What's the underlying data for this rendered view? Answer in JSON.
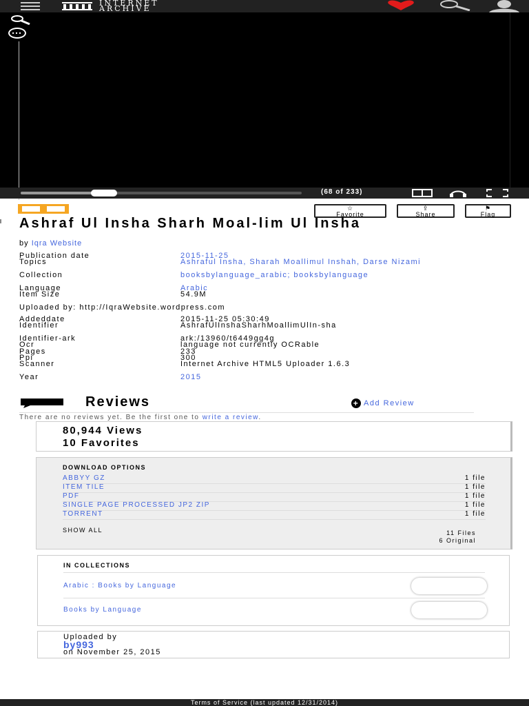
{
  "nav": {
    "logo_line1": "INTERNET",
    "logo_line2": "ARCHIVE"
  },
  "viewer": {
    "page_info": "(68 of 233)",
    "progress": 0.29
  },
  "actions": {
    "favorite": "Favorite",
    "share": "Share",
    "flag": "Flag"
  },
  "item": {
    "title": "Ashraf Ul Insha Sharh Moal-lim Ul Insha",
    "by_label": "by",
    "author": "Iqra Website"
  },
  "metadata1": [
    {
      "key": "Publication date",
      "value": "2015-11-25",
      "link": true
    },
    {
      "key": "Topics",
      "value": "Ashraful Insha, Sharah Moallimul Inshah, Darse Nizami",
      "link": true
    },
    {
      "key": "Collection",
      "value": "booksbylanguage_arabic; booksbylanguage",
      "link": true
    },
    {
      "key": "Language",
      "value": "Arabic",
      "link": true
    },
    {
      "key": "Item Size",
      "value": "54.9M",
      "link": false
    }
  ],
  "uploaded_by_line": "Uploaded by: http://IqraWebsite.wordpress.com",
  "metadata2": [
    {
      "key": "Addeddate",
      "value": "2015-11-25 05:30:49",
      "link": false
    },
    {
      "key": "Identifier",
      "value": "AshrafUlInshaSharhMoallimUlIn-sha",
      "link": false
    },
    {
      "key": "Identifier-ark",
      "value": "ark:/13960/t6449gg4g",
      "link": false
    },
    {
      "key": "Ocr",
      "value": "language not currently OCRable",
      "link": false
    },
    {
      "key": "Pages",
      "value": "233",
      "link": false
    },
    {
      "key": "Ppi",
      "value": "300",
      "link": false
    },
    {
      "key": "Scanner",
      "value": "Internet Archive HTML5 Uploader 1.6.3",
      "link": false
    },
    {
      "key": "Year",
      "value": "2015",
      "link": true
    }
  ],
  "reviews": {
    "title": "Reviews",
    "add_review": "Add Review",
    "empty_prefix": "There are no reviews yet. Be the first one to ",
    "empty_link": "write a review",
    "empty_suffix": "."
  },
  "stats": {
    "views": "80,944 Views",
    "favorites": "10 Favorites"
  },
  "downloads": {
    "heading": "DOWNLOAD OPTIONS",
    "items": [
      {
        "name": "ABBYY GZ",
        "count": "1 file"
      },
      {
        "name": "ITEM TILE",
        "count": "1 file"
      },
      {
        "name": "PDF",
        "count": "1 file"
      },
      {
        "name": "SINGLE PAGE PROCESSED JP2 ZIP",
        "count": "1 file"
      },
      {
        "name": "TORRENT",
        "count": "1 file"
      }
    ],
    "show_all": "SHOW ALL",
    "files_total": "11 Files",
    "files_original": "6 Original"
  },
  "collections": {
    "heading": "IN COLLECTIONS",
    "items": [
      "Arabic : Books by Language",
      "Books by Language"
    ]
  },
  "uploader": {
    "label": "Uploaded by",
    "user": "by993",
    "date": "on November 25, 2015"
  },
  "footer": "Terms of Service (last updated 12/31/2014)",
  "colors": {
    "link": "#4466dd",
    "accent_orange": "#f5a623",
    "heart": "#e21b1b",
    "dark_bar": "#222222"
  }
}
